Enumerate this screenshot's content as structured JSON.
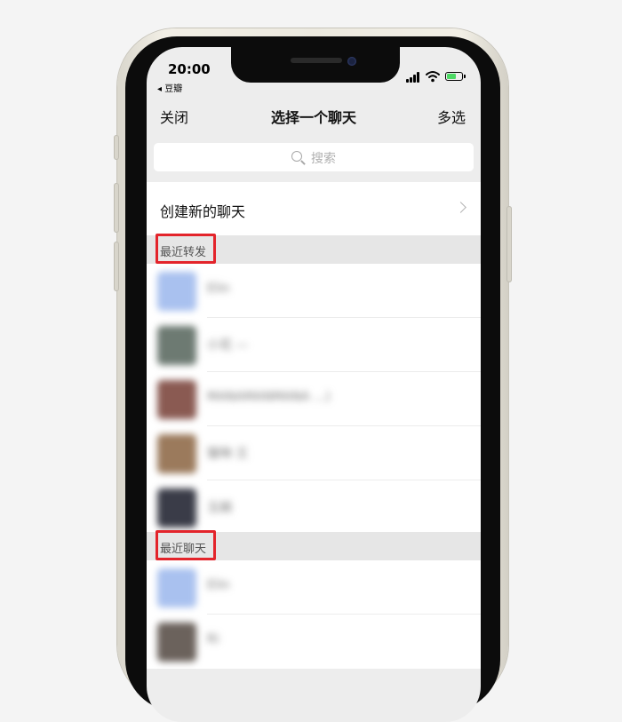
{
  "status_bar": {
    "time": "20:00",
    "back_app": "◂ 豆瓣"
  },
  "nav": {
    "close_label": "关闭",
    "title": "选择一个聊天",
    "multi_select_label": "多选"
  },
  "search": {
    "placeholder": "搜索"
  },
  "create_chat": {
    "label": "创建新的聊天"
  },
  "recent_forward": {
    "header": "最近转发",
    "items": [
      {
        "name": "Elin",
        "avatar_color": "#a9c1ef"
      },
      {
        "name": "小花 —",
        "avatar_color": "#6d7a72"
      },
      {
        "name": "MANAMANMANA ...)",
        "avatar_color": "#8a5a52"
      },
      {
        "name": "猫咪·王",
        "avatar_color": "#9b7a5c"
      },
      {
        "name": "玉娟",
        "avatar_color": "#3a3c48"
      }
    ]
  },
  "recent_chat": {
    "header": "最近聊天",
    "items": [
      {
        "name": "Elin",
        "avatar_color": "#a9c1ef"
      },
      {
        "name": "Ri",
        "avatar_color": "#6b625c"
      }
    ]
  },
  "colors": {
    "highlight": "#e3242b",
    "battery": "#4cd964",
    "background": "#ededed"
  }
}
